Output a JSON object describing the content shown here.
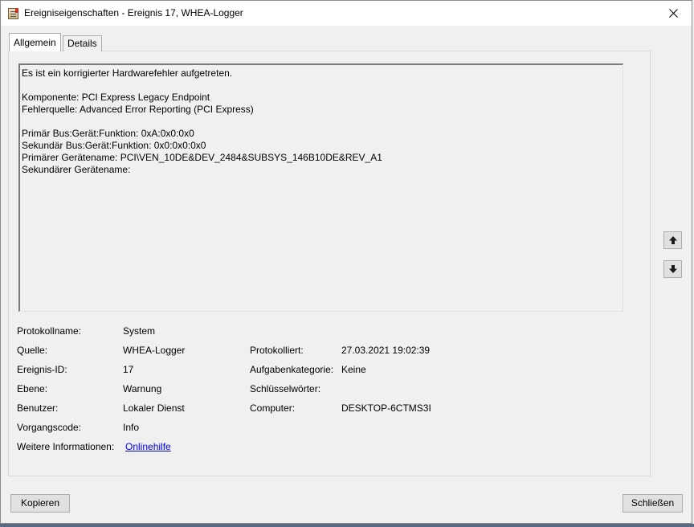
{
  "window": {
    "title": "Ereigniseigenschaften - Ereignis 17, WHEA-Logger"
  },
  "tabs": [
    {
      "label": "Allgemein",
      "active": true
    },
    {
      "label": "Details",
      "active": false
    }
  ],
  "description": {
    "lines": [
      "Es ist ein korrigierter Hardwarefehler aufgetreten.",
      "",
      "Komponente: PCI Express Legacy Endpoint",
      "Fehlerquelle: Advanced Error Reporting (PCI Express)",
      "",
      "Primär Bus:Gerät:Funktion: 0xA:0x0:0x0",
      "Sekundär Bus:Gerät:Funktion: 0x0:0x0:0x0",
      "Primärer Gerätename: PCI\\VEN_10DE&DEV_2484&SUBSYS_146B10DE&REV_A1",
      "Sekundärer Gerätename:"
    ]
  },
  "fields": {
    "protokollname": {
      "label": "Protokollname:",
      "value": "System"
    },
    "quelle": {
      "label": "Quelle:",
      "value": "WHEA-Logger"
    },
    "protokolliert": {
      "label": "Protokolliert:",
      "value": "27.03.2021 19:02:39"
    },
    "ereignis_id": {
      "label": "Ereignis-ID:",
      "value": "17"
    },
    "aufgabenkategorie": {
      "label": "Aufgabenkategorie:",
      "value": "Keine"
    },
    "ebene": {
      "label": "Ebene:",
      "value": "Warnung"
    },
    "schluesselwoerter": {
      "label": "Schlüsselwörter:",
      "value": ""
    },
    "benutzer": {
      "label": "Benutzer:",
      "value": "Lokaler Dienst"
    },
    "computer": {
      "label": "Computer:",
      "value": "DESKTOP-6CTMS3I"
    },
    "vorgangscode": {
      "label": "Vorgangscode:",
      "value": "Info"
    },
    "weitere_informationen": {
      "label": "Weitere Informationen:",
      "value": "Onlinehilfe"
    }
  },
  "buttons": {
    "copy": "Kopieren",
    "close": "Schließen"
  },
  "icons": {
    "up": "arrow-up-icon",
    "down": "arrow-down-icon",
    "close": "close-icon",
    "app": "event-viewer-icon"
  }
}
